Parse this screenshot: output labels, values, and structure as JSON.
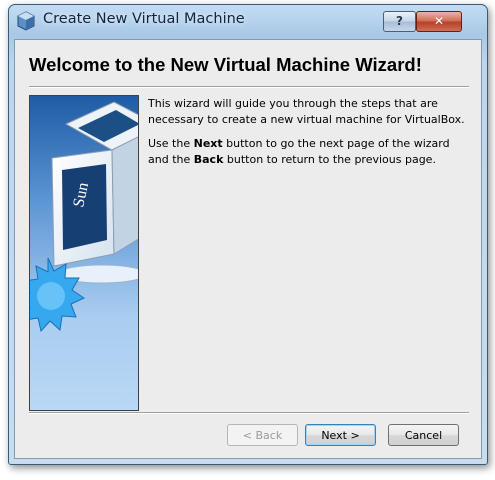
{
  "window": {
    "title": "Create New Virtual Machine",
    "help_label": "?",
    "close_label": "✕"
  },
  "wizard": {
    "heading": "Welcome to the New Virtual Machine Wizard!",
    "paragraph1": "This wizard will guide you through the steps that are necessary to create a new virtual machine for VirtualBox.",
    "paragraph2": {
      "prefix": "Use the ",
      "next_word": "Next",
      "middle": " button to go the next page of the wizard and the ",
      "back_word": "Back",
      "suffix": " button to return to the previous page."
    },
    "image_logo_text": "Sun"
  },
  "buttons": {
    "back": "< Back",
    "next": "Next >",
    "cancel": "Cancel"
  },
  "colors": {
    "panel_bg": "#ececec",
    "image_bg": "#a8cdf0",
    "logo_blue": "#1c4f86",
    "starburst": "#2fa0e8"
  }
}
